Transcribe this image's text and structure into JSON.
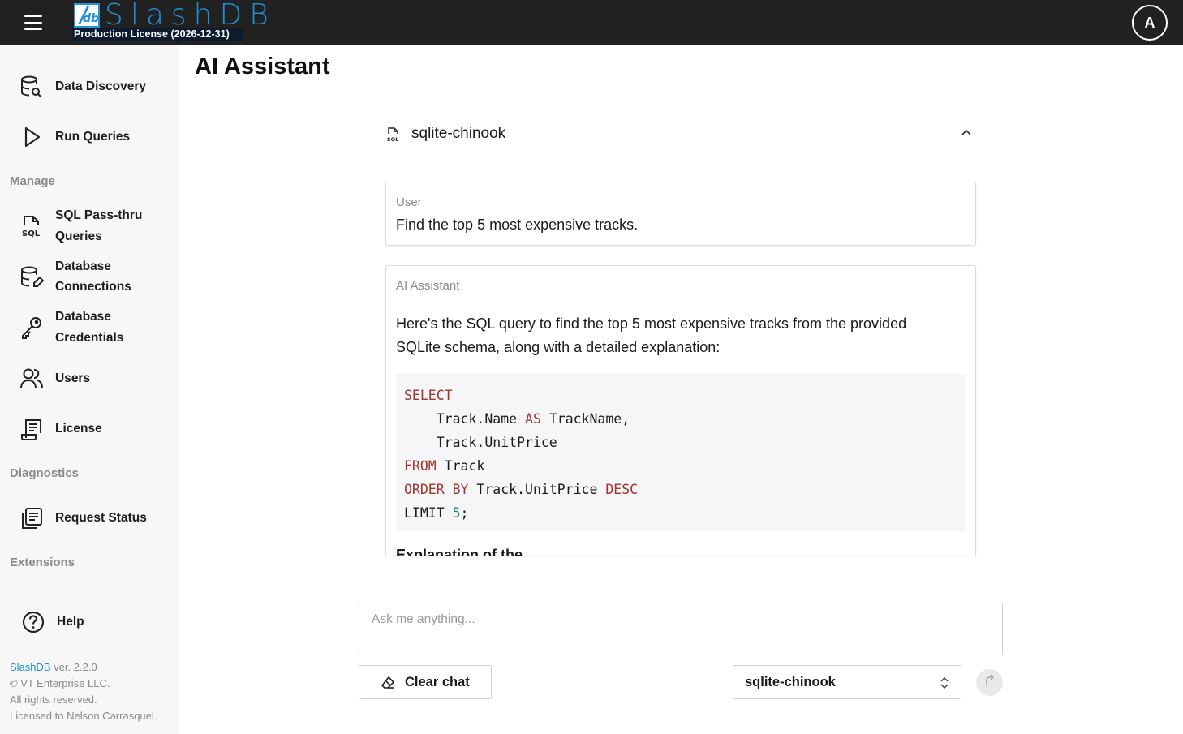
{
  "header": {
    "logo_text": "SlashDB",
    "license_label": "Production License (2026-12-31)",
    "avatar_initial": "A",
    "icons": {
      "menu": "hamburger-icon",
      "avatar": "avatar"
    }
  },
  "sidebar": {
    "items_top": [
      {
        "label": "Data Discovery",
        "icon": "database-search-icon"
      },
      {
        "label": "Run Queries",
        "icon": "play-icon"
      }
    ],
    "manage_title": "Manage",
    "manage_items": [
      {
        "label_line1": "SQL Pass-thru",
        "label_line2": "Queries",
        "icon": "sql-file-icon"
      },
      {
        "label_line1": "Database",
        "label_line2": "Connections",
        "icon": "database-edit-icon"
      },
      {
        "label_line1": "Database",
        "label_line2": "Credentials",
        "icon": "key-icon"
      },
      {
        "label": "Users",
        "icon": "users-icon"
      },
      {
        "label": "License",
        "icon": "license-icon"
      }
    ],
    "diagnostics_title": "Diagnostics",
    "diagnostics_items": [
      {
        "label": "Request Status",
        "icon": "request-status-icon"
      }
    ],
    "extensions_title": "Extensions",
    "help_label": "Help",
    "footer": {
      "brand": "SlashDB",
      "version": " ver. 2.2.0",
      "copyright": "© VT Enterprise LLC.",
      "rights": "All rights reserved.",
      "licensed_to": "Licensed to Nelson Carrasquel."
    }
  },
  "main": {
    "title": "AI Assistant",
    "database_name": "sqlite-chinook",
    "messages": [
      {
        "role": "User",
        "text": "Find the top 5 most expensive tracks."
      },
      {
        "role": "AI Assistant",
        "intro_line1": "Here's the SQL query to find the top 5 most expensive tracks from the provided",
        "intro_line2": "SQLite schema, along with a detailed explanation:",
        "code": {
          "select": "SELECT",
          "line2_a": "    Track.Name ",
          "as": "AS",
          "line2_b": " TrackName,",
          "line3": "    Track.UnitPrice",
          "from": "FROM",
          "line4_b": " Track",
          "order": "ORDER",
          "by": "BY",
          "line5_b": " Track.UnitPrice ",
          "desc": "DESC",
          "limit": "LIMIT ",
          "limit_value": "5",
          "semicolon": ";"
        },
        "cut_heading": "Explanation of the"
      }
    ],
    "input": {
      "placeholder": "Ask me anything...",
      "value": ""
    },
    "clear_button": "Clear chat",
    "selected_database": "sqlite-chinook"
  },
  "colors": {
    "topbar": "#212121",
    "brand_blue": "#1f8fd8",
    "sql_keyword": "#a0352e",
    "sql_number": "#2a8a6a"
  }
}
